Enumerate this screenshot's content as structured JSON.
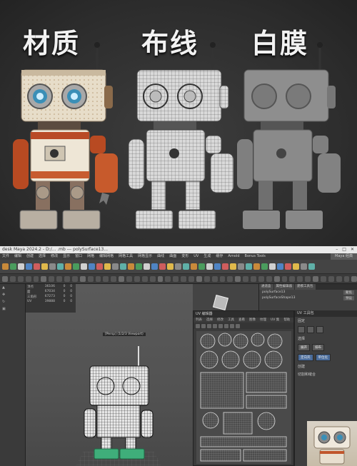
{
  "titles": {
    "material": "材质",
    "wireframe": "布线",
    "clay": "白膜"
  },
  "maya": {
    "window_title": "desk Maya 2024.2 - D:/... .mb --- polySurface13...",
    "menu": [
      "文件",
      "编辑",
      "创建",
      "选择",
      "修改",
      "显示",
      "窗口",
      "网格",
      "编辑网格",
      "网格工具",
      "网格显示",
      "曲线",
      "曲面",
      "变形",
      "UV",
      "生成",
      "缓存",
      "Arnold",
      "Bonus Tools",
      "帮助"
    ],
    "workspace_label": "Maya 经典",
    "viewport_label": "[Persp] (1/2/3 Viewport)",
    "outliner_rows": [
      [
        "顶点",
        "36106",
        "0",
        "0"
      ],
      [
        "面",
        "67034",
        "0",
        "0"
      ],
      [
        "三角形",
        "67273",
        "0",
        "0"
      ],
      [
        "UV",
        "39888",
        "0",
        "0"
      ]
    ],
    "uv_editor": {
      "title": "UV 编辑器",
      "menu": [
        "列表",
        "选择",
        "修改",
        "工具",
        "查看",
        "图像",
        "纹理",
        "UV 集",
        "帮助"
      ]
    },
    "uv_toolkit": {
      "title": "UV 工具包",
      "section_pin": "固定",
      "section_select": "选择",
      "btn_unfold": "展开",
      "btn_layout": "排布",
      "btn_orient": "定向壳",
      "btn_unitize": "单位化",
      "section_create": "创建",
      "section_cut": "切割和缝合"
    },
    "attr_editor": {
      "tabs": [
        "通道盒",
        "属性编辑器",
        "建模工具包"
      ],
      "node": "polySurface13",
      "shape": "polySurfaceShape13",
      "focus": "聚焦",
      "presets": "预设"
    }
  },
  "colors": {
    "shelf_icons": [
      "#c98a3a",
      "#4a9c5d",
      "#d0d0d0",
      "#4f84c4",
      "#cf5d5d",
      "#e0b94b",
      "#8a8a8a",
      "#5fb0a8"
    ]
  }
}
